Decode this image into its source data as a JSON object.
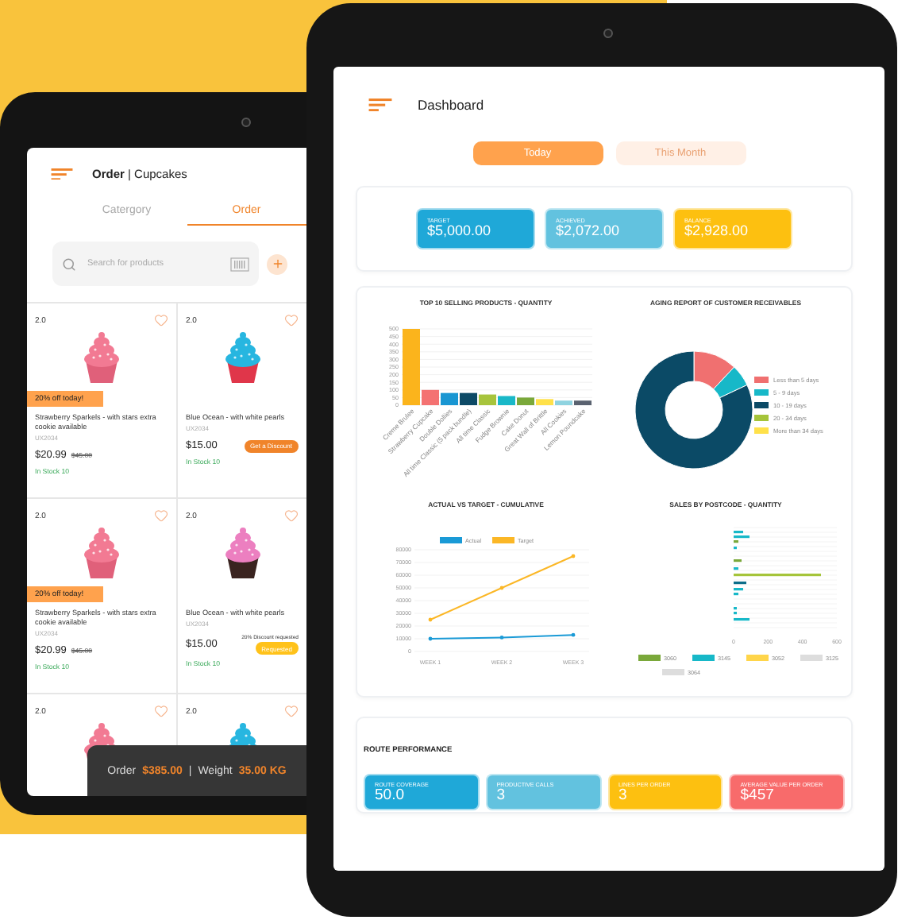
{
  "order_screen": {
    "title": "**Order** | Cupcakes",
    "tabs": [
      {
        "label": "Catergory",
        "selected": false
      },
      {
        "label": "Order",
        "selected": true
      }
    ],
    "search": {
      "placeholder": "Search for products"
    },
    "products": [
      {
        "rating": "2.0",
        "color": "#f27a93",
        "kind": "pink",
        "badge": "20% off today!",
        "name": "Strawberry Sparkels - with stars extra cookie available",
        "sku": "UX2034",
        "price": "$20.99",
        "old_price": "$45.00",
        "stock": "In Stock 10"
      },
      {
        "rating": "2.0",
        "color": "#27b6e0",
        "kind": "red",
        "name": "Blue Ocean - with white pearls",
        "sku": "UX2034",
        "price": "$15.00",
        "stock": "In Stock 10",
        "action": {
          "kind": "discount",
          "label": "Get a Discount"
        }
      },
      {
        "rating": "2.0",
        "color": "#f27a93",
        "kind": "pink",
        "badge": "20% off today!",
        "name": "Strawberry Sparkels - with stars extra cookie available",
        "sku": "UX2034",
        "price": "$20.99",
        "old_price": "$45.00",
        "stock": "In Stock 10"
      },
      {
        "rating": "2.0",
        "color": "#ec7fc0",
        "kind": "chocolate",
        "name": "Blue Ocean - with white pearls",
        "sku": "UX2034",
        "price": "$15.00",
        "stock": "In Stock 10",
        "note": "20% Discount requested",
        "action": {
          "kind": "requested",
          "label": "Requested"
        }
      },
      {
        "rating": "2.0",
        "color": "#f27a93",
        "kind": "pink"
      },
      {
        "rating": "2.0",
        "color": "#27b6e0",
        "kind": "red"
      }
    ],
    "summary": {
      "order_label": "Order",
      "order_value": "$385.00",
      "separator": "|",
      "weight_label": "Weight",
      "weight_value": "35.00 KG"
    }
  },
  "dashboard": {
    "title": "Dashboard",
    "periods": [
      {
        "label": "Today",
        "selected": true
      },
      {
        "label": "This Month",
        "selected": false
      }
    ],
    "balances": [
      {
        "label": "TARGET",
        "value": "$5,000.00",
        "color": "#1fa8d8"
      },
      {
        "label": "ACHIEVED",
        "value": "$2,072.00",
        "color": "#62c2df"
      },
      {
        "label": "BALANCE",
        "value": "$2,928.00",
        "color": "#fdc010"
      }
    ],
    "charts": [
      {
        "chart_data": {
          "type": "bar",
          "title": "TOP 10 SELLING PRODUCTS - QUANTITY",
          "categories": [
            "Creme Brulee",
            "Strawberry Cupcake",
            "Double Dollies",
            "All time Classic (5 pack bundle)",
            "All time Classic",
            "Fudge Brownie",
            "Cake Donut",
            "Great Wall of Brittle",
            "All Cookies",
            "Lemon Poundcake"
          ],
          "values": [
            500,
            100,
            80,
            80,
            70,
            60,
            50,
            40,
            30,
            30
          ],
          "grid": true,
          "ylim": [
            0,
            500
          ],
          "yticks": [
            0,
            50,
            100,
            150,
            200,
            250,
            300,
            350,
            400,
            450,
            500
          ]
        }
      },
      {
        "chart_data": {
          "type": "donut",
          "title": "AGING REPORT OF CUSTOMER RECEIVABLES",
          "categories": [
            "Less than 5 days",
            "5 - 9 days",
            "10 - 19 days",
            "20 - 34 days",
            "More than 34 days"
          ],
          "values": [
            12,
            6,
            82,
            0,
            0
          ],
          "legend": "right",
          "colors": [
            "#f07070",
            "#17b8c8",
            "#0b4a66",
            "#a5c43a",
            "#ffe14a"
          ]
        }
      },
      {
        "chart_data": {
          "type": "line",
          "title": "ACTUAL VS TARGET - CUMULATIVE",
          "categories": [
            "WEEK 1",
            "WEEK 2",
            "WEEK 3"
          ],
          "series": [
            {
              "name": "Actual",
              "color": "#1a9ad6",
              "values": [
                10000,
                11000,
                13000
              ]
            },
            {
              "name": "Target",
              "color": "#fbb726",
              "values": [
                25000,
                50000,
                75000
              ]
            }
          ],
          "grid": true,
          "legend": "top",
          "ylim": [
            0,
            80000
          ],
          "yticks": [
            0,
            10000,
            20000,
            30000,
            40000,
            50000,
            60000,
            70000,
            80000
          ]
        }
      }
    ],
    "postcode_chart": {
      "title": "SALES BY POSTCODE - QUANTITY",
      "axis_labels": [
        "0",
        "200",
        "400",
        "600"
      ],
      "legend": [
        {
          "label": "3060",
          "color": "#7aa83a"
        },
        {
          "label": "3145",
          "color": "#17b8c8"
        },
        {
          "label": "3052",
          "color": "#ffd54a"
        },
        {
          "label": "3125",
          "color": "#dddddd"
        },
        {
          "label": "3064",
          "color": "#dddddd"
        }
      ]
    },
    "route_performance": {
      "title": "ROUTE PERFORMANCE",
      "tiles": [
        {
          "label": "ROUTE COVERAGE",
          "value": "50.0",
          "color": "#1fa8d8"
        },
        {
          "label": "PRODUCTIVE CALLS",
          "value": "3",
          "color": "#62c2df"
        },
        {
          "label": "LINES PER ORDER",
          "value": "3",
          "color": "#fdc010"
        },
        {
          "label": "AVERAGE VALUE PER ORDER",
          "value": "$457",
          "color": "#f86b6b"
        }
      ]
    }
  }
}
